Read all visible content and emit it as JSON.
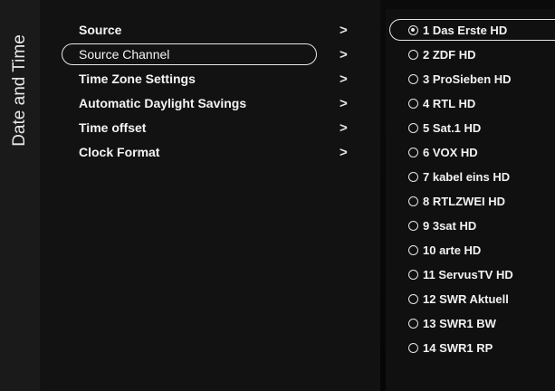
{
  "sidebar": {
    "title": "Date and Time"
  },
  "menu": {
    "items": [
      {
        "label": "Source",
        "chevron": ">"
      },
      {
        "label": "Source Channel",
        "chevron": ">"
      },
      {
        "label": "Time Zone Settings",
        "chevron": ">"
      },
      {
        "label": "Automatic Daylight Savings",
        "chevron": ">"
      },
      {
        "label": "Time offset",
        "chevron": ">"
      },
      {
        "label": "Clock Format",
        "chevron": ">"
      }
    ],
    "selected_label": "Source Channel"
  },
  "channels": {
    "items": [
      {
        "label": "1 Das Erste HD",
        "checked": true
      },
      {
        "label": "2 ZDF HD",
        "checked": false
      },
      {
        "label": "3 ProSieben HD",
        "checked": false
      },
      {
        "label": "4 RTL HD",
        "checked": false
      },
      {
        "label": "5 Sat.1 HD",
        "checked": false
      },
      {
        "label": "6 VOX HD",
        "checked": false
      },
      {
        "label": "7 kabel eins HD",
        "checked": false
      },
      {
        "label": "8 RTLZWEI HD",
        "checked": false
      },
      {
        "label": "9 3sat HD",
        "checked": false
      },
      {
        "label": "10 arte HD",
        "checked": false
      },
      {
        "label": "11 ServusTV HD",
        "checked": false
      },
      {
        "label": "12 SWR Aktuell",
        "checked": false
      },
      {
        "label": "13 SWR1 BW",
        "checked": false
      },
      {
        "label": "14 SWR1 RP",
        "checked": false
      }
    ]
  },
  "colors": {
    "background": "#050505",
    "panel": "#121212",
    "text": "#f2f2f2",
    "highlight_border": "#e6e6e6"
  }
}
